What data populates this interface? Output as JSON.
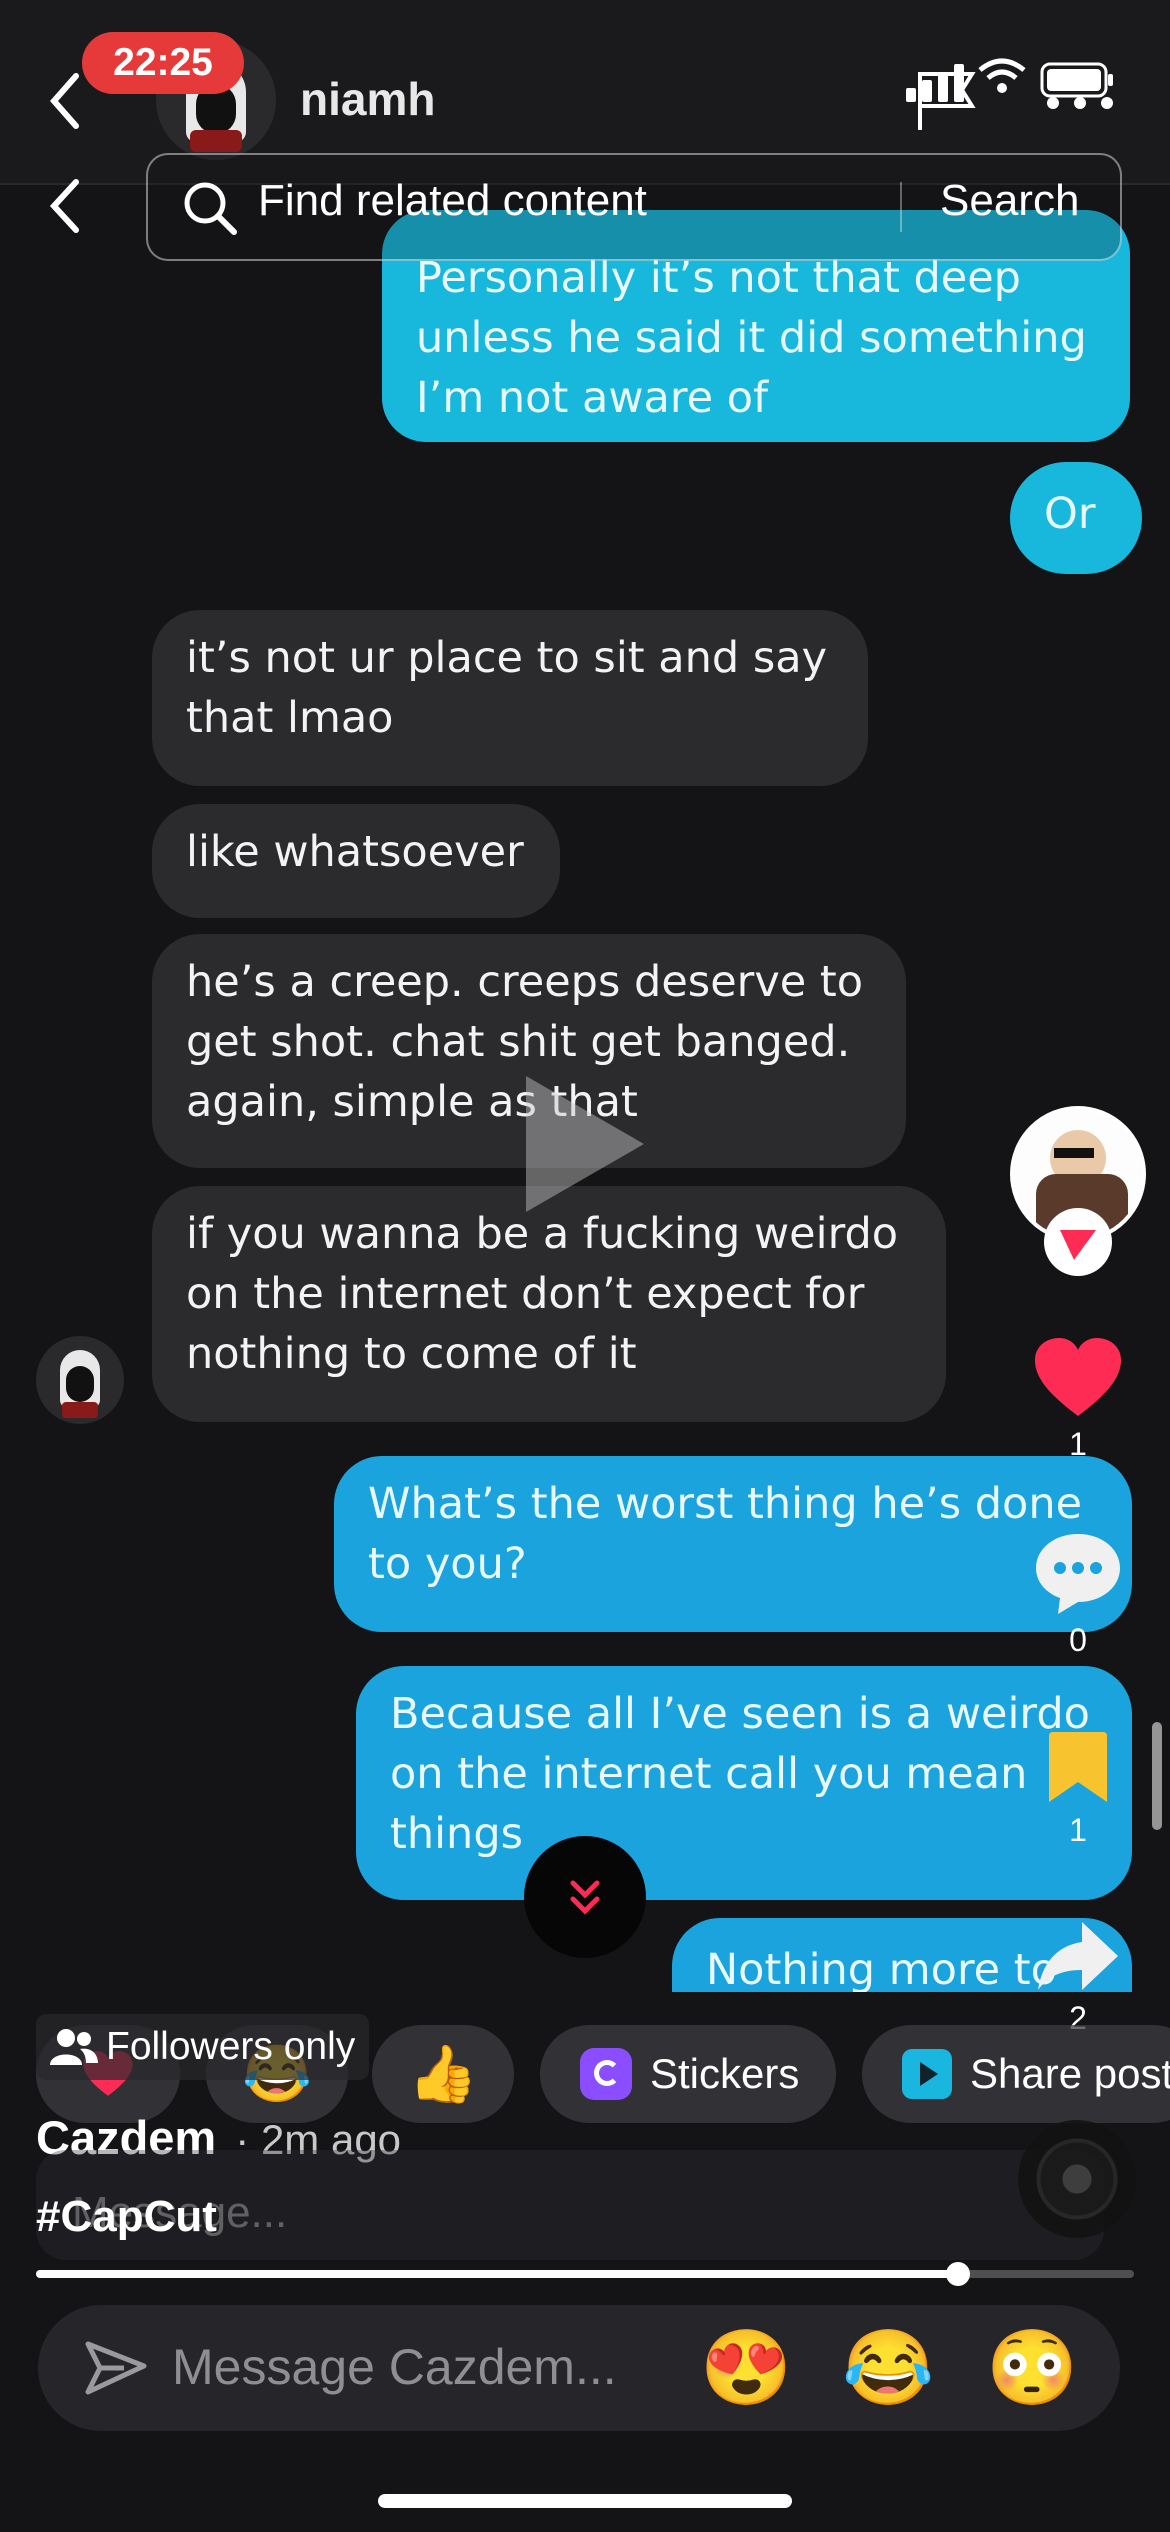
{
  "status_bar": {
    "time": "22:25"
  },
  "chat_header": {
    "contact_name": "niamh"
  },
  "search": {
    "placeholder": "Find related content",
    "button": "Search"
  },
  "messages": [
    {
      "dir": "out",
      "text": "Personally it’s not that deep\nunless he said it did something\nI’m not aware of"
    },
    {
      "dir": "out",
      "text": "Or"
    },
    {
      "dir": "in",
      "text": "it’s not ur place to sit and say\nthat lmao"
    },
    {
      "dir": "in",
      "text": "like whatsoever"
    },
    {
      "dir": "in",
      "text": "he’s a creep. creeps deserve to\nget shot. chat shit get banged.\nagain, simple as that"
    },
    {
      "dir": "in",
      "text": "if you wanna be a fucking weirdo\non the internet don’t expect for\nnothing to come of it"
    },
    {
      "dir": "out",
      "text": "What’s the worst thing he’s done\nto you?"
    },
    {
      "dir": "out",
      "text": "Because all I’ve seen is a weirdo\non the internet call you mean\nthings"
    },
    {
      "dir": "out",
      "text": "Nothing more to"
    }
  ],
  "actions": {
    "likes": "1",
    "comments": "0",
    "saves": "1",
    "shares": "2"
  },
  "post": {
    "audience": "Followers only",
    "author": "Cazdem",
    "time": "· 2m ago",
    "caption": "#CapCut",
    "message_placeholder": "Message..."
  },
  "progress": {
    "fraction": 0.84
  },
  "quick_replies": {
    "stickers": "Stickers",
    "share_post": "Share post"
  },
  "bottom": {
    "placeholder": "Message Cazdem...",
    "emojis": [
      "😍",
      "😂",
      "😳"
    ]
  },
  "colors": {
    "outgoing_bubble": "#1aa3dc",
    "incoming_bubble": "#2b2b2e",
    "accent_red": "#fe2c55",
    "save_yellow": "#f7c430"
  }
}
